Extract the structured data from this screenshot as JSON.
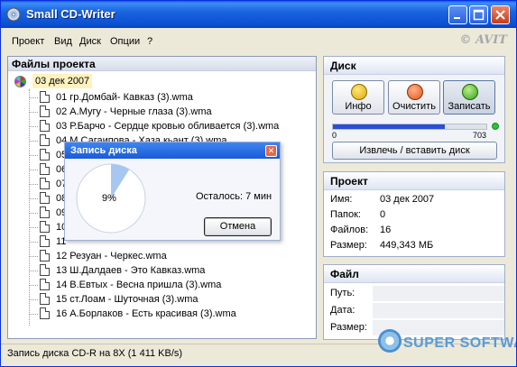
{
  "window": {
    "title": "Small CD-Writer"
  },
  "menu": {
    "items": [
      "Проект",
      "Вид",
      "Диск",
      "Опции",
      "?"
    ],
    "copyright": "© AVIT"
  },
  "files_panel": {
    "header": "Файлы проекта",
    "root": "03 дек 2007",
    "tracks": [
      "01 гр.Домбай- Кавказ (3).wma",
      "02 А.Мугу - Черные глаза (3).wma",
      "03 Р.Барчо - Сердце кровью обливается (3).wma",
      "04 М.Сагаипова - Хаза кьант (3).wma",
      "05",
      "06",
      "07",
      "08",
      "09",
      "10",
      "11",
      "12 Резуан - Черкес.wma",
      "13 Ш.Далдаев - Это Кавказ.wma",
      "14 В.Евтых - Весна пришла (3).wma",
      "15 ст.Лоам - Шуточная (3).wma",
      "16 А.Борлаков - Есть красивая (3).wma"
    ]
  },
  "disk_panel": {
    "header": "Диск",
    "buttons": {
      "info": "Инфо",
      "clear": "Очистить",
      "burn": "Записать"
    },
    "progress": {
      "min": "0",
      "max": "703",
      "fraction": 0.73
    },
    "eject": "Извлечь / вставить диск"
  },
  "project_panel": {
    "header": "Проект",
    "rows": [
      {
        "label": "Имя:",
        "value": "03 дек 2007"
      },
      {
        "label": "Папок:",
        "value": "0"
      },
      {
        "label": "Файлов:",
        "value": "16"
      },
      {
        "label": "Размер:",
        "value": "449,343 МБ"
      }
    ]
  },
  "file_panel": {
    "header": "Файл",
    "rows": [
      {
        "label": "Путь:"
      },
      {
        "label": "Дата:"
      },
      {
        "label": "Размер:"
      }
    ]
  },
  "status": {
    "text": "Запись диска CD-R на 8X (1 411 KB/s)"
  },
  "watermark": {
    "text": "SUPER SOFTWARE"
  },
  "dialog": {
    "title": "Запись диска",
    "percent": "9%",
    "progress_fraction": 0.09,
    "remaining": "Осталось: 7 мин",
    "cancel": "Отмена"
  }
}
